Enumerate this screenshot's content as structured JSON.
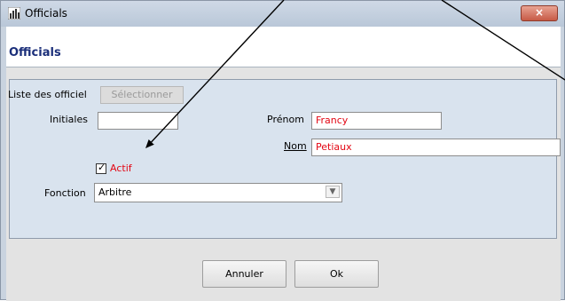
{
  "window": {
    "title": "Officials",
    "close_glyph": "×",
    "icon": "chart-icon"
  },
  "header": {
    "title": "Officials"
  },
  "form": {
    "liste_label": "Liste des officiel",
    "select_button": "Sélectionner",
    "initiales_label": "Initiales",
    "initiales_value": "",
    "prenom_label": "Prénom",
    "prenom_value": "Francy",
    "nom_label": "Nom",
    "nom_value": "Petiaux",
    "actif_label": "Actif",
    "actif_checked": true,
    "fonction_label": "Fonction",
    "fonction_value": "Arbitre"
  },
  "buttons": {
    "cancel": "Annuler",
    "ok": "Ok"
  },
  "colors": {
    "value_text": "#e30613",
    "title_blue": "#1b2f7a",
    "annotation": "#000000"
  }
}
